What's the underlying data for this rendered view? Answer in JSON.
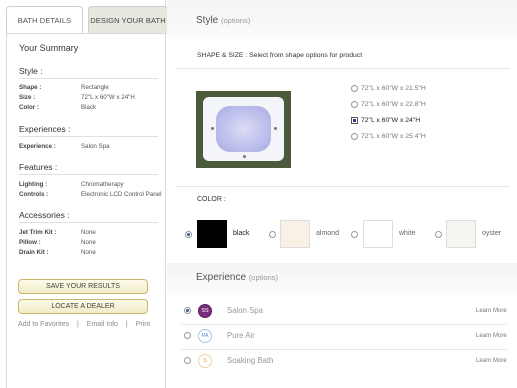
{
  "tabs": {
    "bath_details": "BATH DETAILS",
    "design_your_bath": "DESIGN YOUR BATH"
  },
  "summary": {
    "title": "Your Summary",
    "style": {
      "heading": "Style :",
      "rows": [
        {
          "label": "Shape :",
          "value": "Rectangle"
        },
        {
          "label": "Size :",
          "value": "72\"L x 60\"W x 24\"H"
        },
        {
          "label": "Color :",
          "value": "Black"
        }
      ]
    },
    "experiences": {
      "heading": "Experiences :",
      "rows": [
        {
          "label": "Experience :",
          "value": "Salon Spa"
        }
      ]
    },
    "features": {
      "heading": "Features :",
      "rows": [
        {
          "label": "Lighting :",
          "value": "Chromatherapy"
        },
        {
          "label": "Controls :",
          "value": "Electronic LCD Control Panel"
        }
      ]
    },
    "accessories": {
      "heading": "Accessories :",
      "rows": [
        {
          "label": "Jet Trim Kit :",
          "value": "None"
        },
        {
          "label": "Pillow :",
          "value": "None"
        },
        {
          "label": "Drain Kit :",
          "value": "None"
        }
      ]
    },
    "save_button": "SAVE YOUR RESULTS",
    "dealer_button": "LOCATE A DEALER",
    "links": {
      "favorites": "Add to Favorites",
      "separator": "|",
      "email": "Email Info",
      "print": "Print"
    }
  },
  "style_section": {
    "title": "Style",
    "subtitle": "(options)",
    "shape_size_label": "SHAPE & SIZE",
    "shape_size_hint": " : Select from shape options for product",
    "size_options": [
      {
        "label": "72\"L x 60\"W x 21.5\"H",
        "selected": false
      },
      {
        "label": "72\"L x 60\"W x 22.8\"H",
        "selected": false
      },
      {
        "label": "72\"L x 60\"W x 24\"H",
        "selected": true
      },
      {
        "label": "72\"L x 60\"W x 25.4\"H",
        "selected": false
      }
    ],
    "color_label": "COLOR :",
    "colors": [
      {
        "name": "black",
        "hex": "#000000",
        "selected": true
      },
      {
        "name": "almond",
        "hex": "#f7f1e6",
        "selected": false
      },
      {
        "name": "white",
        "hex": "#ffffff",
        "selected": false
      },
      {
        "name": "oyster",
        "hex": "#f6f5f2",
        "selected": false
      }
    ]
  },
  "experience_section": {
    "title": "Experience",
    "subtitle": "(options)",
    "items": [
      {
        "name": "Salon Spa",
        "badge": "SS",
        "badge_color": "#7b2f7f",
        "learn": "Learn More",
        "selected": true
      },
      {
        "name": "Pure Air",
        "badge": "PA",
        "badge_color": "#5a8fc4",
        "learn": "Learn More",
        "selected": false
      },
      {
        "name": "Soaking Bath",
        "badge": "S",
        "badge_color": "#d9a64a",
        "learn": "Learn More",
        "selected": false
      }
    ]
  }
}
